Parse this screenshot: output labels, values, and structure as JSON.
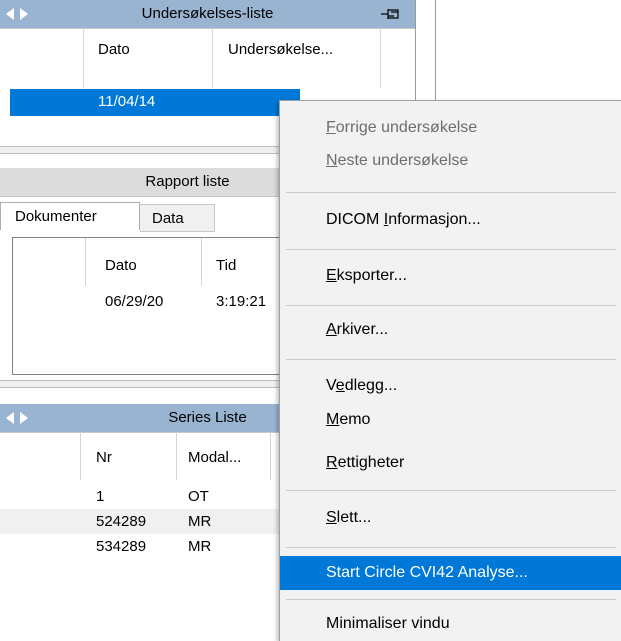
{
  "exam_panel": {
    "title": "Undersøkelses-liste",
    "columns": [
      "Dato",
      "Undersøkelse..."
    ],
    "rows": [
      {
        "dato": "11/04/14"
      }
    ]
  },
  "report_panel": {
    "title": "Rapport liste",
    "tabs": [
      "Dokumenter",
      "Data"
    ],
    "columns": [
      "Dato",
      "Tid"
    ],
    "rows": [
      {
        "dato": "06/29/20",
        "tid": "3:19:21"
      }
    ]
  },
  "series_panel": {
    "title": "Series Liste",
    "columns": [
      "Nr",
      "Modal..."
    ],
    "rows": [
      {
        "nr": "1",
        "modal": "OT"
      },
      {
        "nr": "524289",
        "modal": "MR"
      },
      {
        "nr": "534289",
        "modal": "MR"
      }
    ]
  },
  "context_menu": {
    "items": [
      {
        "label": "Forrige undersøkelse",
        "accel": "F",
        "rest": "orrige undersøkelse",
        "disabled": true
      },
      {
        "label": "Neste undersøkelse",
        "accel": "N",
        "rest": "este undersøkelse",
        "disabled": true
      },
      {
        "label": "DICOM Informasjon...",
        "pre": "DICOM ",
        "accel": "I",
        "rest": "nformasjon..."
      },
      {
        "label": "Eksporter...",
        "accel": "E",
        "rest": "ksporter..."
      },
      {
        "label": "Arkiver...",
        "accel": "A",
        "rest": "rkiver..."
      },
      {
        "label": "Vedlegg...",
        "pre": "V",
        "accel": "e",
        "rest": "dlegg..."
      },
      {
        "label": "Memo",
        "accel": "M",
        "rest": "emo"
      },
      {
        "label": "Rettigheter",
        "accel": "R",
        "rest": "ettigheter"
      },
      {
        "label": "Slett...",
        "accel": "S",
        "rest": "lett..."
      },
      {
        "label": "Start Circle CVI42 Analyse...",
        "highlighted": true
      },
      {
        "label": "Minimaliser vindu"
      }
    ]
  },
  "colors": {
    "selection": "#0078d7",
    "title_active": "#99b4d1",
    "title_inactive": "#dcdcdc",
    "menu_bg": "#f2f2f2",
    "disabled_text": "#6d6d6d"
  }
}
